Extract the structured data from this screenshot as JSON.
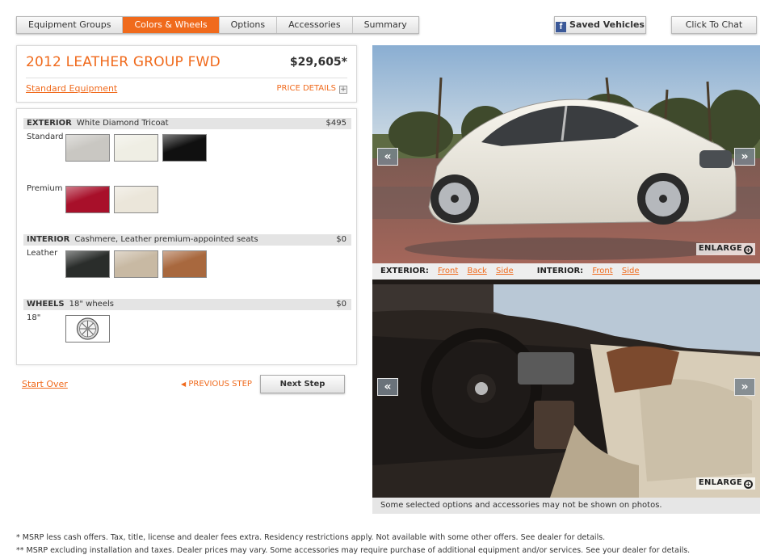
{
  "tabs": [
    {
      "label": "Equipment Groups"
    },
    {
      "label": "Colors & Wheels"
    },
    {
      "label": "Options"
    },
    {
      "label": "Accessories"
    },
    {
      "label": "Summary"
    }
  ],
  "saved_vehicles": "Saved Vehicles",
  "click_to_chat": "Click To Chat",
  "model": {
    "title": "2012 LEATHER GROUP FWD",
    "price": "$29,605*",
    "standard_equipment": "Standard Equipment",
    "price_details": "PRICE DETAILS"
  },
  "exterior": {
    "label": "EXTERIOR",
    "selected": "White Diamond Tricoat",
    "price": "$495",
    "standard_label": "Standard",
    "premium_label": "Premium",
    "standard_swatches": [
      "#c9c7c2",
      "#efeee4",
      "#101010"
    ],
    "premium_swatches": [
      "#a8102a",
      "#ebe6da"
    ]
  },
  "interior": {
    "label": "INTERIOR",
    "selected": "Cashmere, Leather premium-appointed seats",
    "price": "$0",
    "sub_label": "Leather",
    "swatches": [
      "#2a2d2b",
      "#c8b9a3",
      "#a8683e"
    ]
  },
  "wheels": {
    "label": "WHEELS",
    "selected": "18\" wheels",
    "price": "$0",
    "sub_label": "18\""
  },
  "nav": {
    "start_over": "Start Over",
    "previous_step": "PREVIOUS STEP",
    "next_step": "Next Step"
  },
  "views": {
    "exterior_label": "EXTERIOR:",
    "exterior_links": [
      "Front",
      "Back",
      "Side"
    ],
    "interior_label": "INTERIOR:",
    "interior_links": [
      "Front",
      "Side"
    ],
    "enlarge": "ENLARGE"
  },
  "photo_disclaimer": "Some selected options and accessories may not be shown on photos.",
  "footnotes": [
    "* MSRP less cash offers. Tax, title, license and dealer fees extra. Residency restrictions apply. Not available with some other offers. See dealer for details.",
    "** MSRP excluding installation and taxes. Dealer prices may vary. Some accessories may require purchase of additional equipment and/or services. See your dealer for details."
  ]
}
